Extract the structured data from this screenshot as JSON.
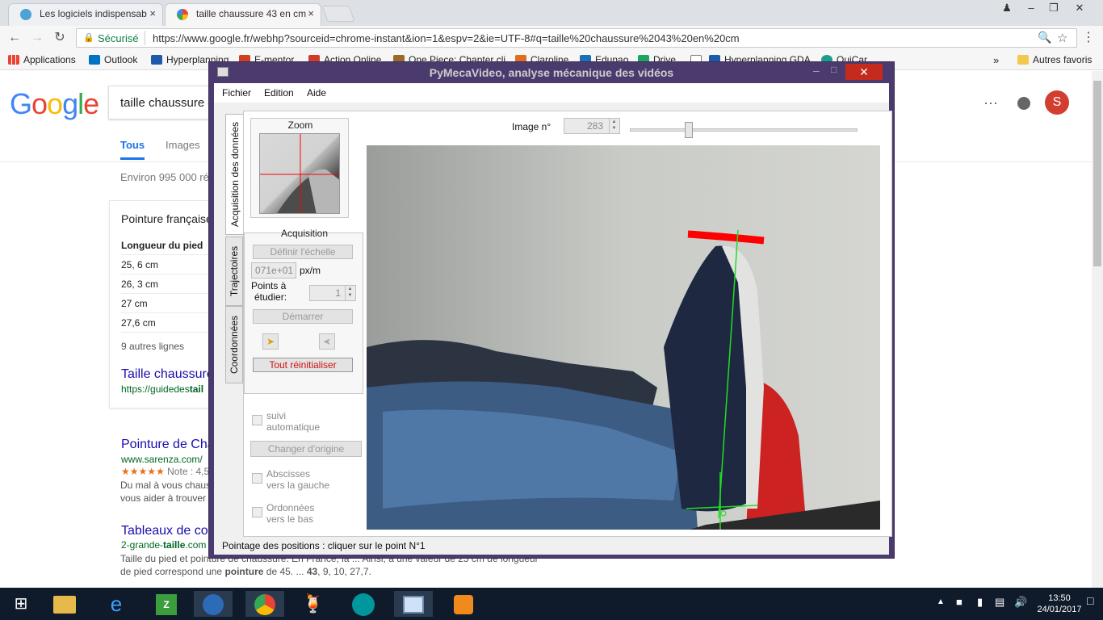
{
  "browser": {
    "tabs": [
      {
        "title": "Les logiciels indispensab",
        "close": "×"
      },
      {
        "title": "taille chaussure 43 en cm",
        "close": "×"
      }
    ],
    "omnibox": {
      "secure_label": "Sécurisé",
      "url": "https://www.google.fr/webhp?sourceid=chrome-instant&ion=1&espv=2&ie=UTF-8#q=taille%20chaussure%2043%20en%20cm"
    },
    "bookmarks": [
      {
        "label": "Applications",
        "color": "#4285f4"
      },
      {
        "label": "Outlook",
        "color": "#0072c6"
      },
      {
        "label": "Hyperplanning",
        "color": "#1e5aa8"
      },
      {
        "label": "E-mentor",
        "color": "#d04020"
      },
      {
        "label": "Action Online",
        "color": "#d13b2b"
      },
      {
        "label": "One Piece: Chapter cli",
        "color": "#9a6b2b"
      },
      {
        "label": "Claroline",
        "color": "#e06d1f"
      },
      {
        "label": "Edunao",
        "color": "#1f6fb5"
      },
      {
        "label": "Drive",
        "color": "#1fa463"
      },
      {
        "label": "",
        "color": "#777777"
      },
      {
        "label": "Hyperplanning GDA",
        "color": "#1e5aa8"
      },
      {
        "label": "QuiCar",
        "color": "#1a9e8a"
      }
    ],
    "bookmarks_more": "»",
    "other_bookmarks": "Autres favoris"
  },
  "google": {
    "logo": "Google",
    "query": "taille chaussure 4",
    "tabs": [
      "Tous",
      "Images"
    ],
    "result_count": "Environ 995 000 rés",
    "card": {
      "title": "Pointure française",
      "header": "Longueur du pied",
      "rows": [
        "25, 6 cm",
        "26, 3 cm",
        "27 cm",
        "27,6 cm"
      ],
      "more": "9 autres lignes",
      "link": "Taille chaussure",
      "url_prefix": "https://guidedes",
      "url_bold": "tail"
    },
    "results": [
      {
        "title": "Pointure de Cha",
        "url": "www.sarenza.com/",
        "rating": "★★★★★",
        "rating_note": "Note : 4,5",
        "snippet1": "Du mal à vous chaus",
        "snippet2": "vous aider à trouver"
      },
      {
        "title": "Tableaux de co",
        "url_prefix": "2-grande-",
        "url_bold": "taille",
        "url_suffix": ".com",
        "snippet1": "Taille du pied et pointure de chaussure. En France, la ... Ainsi, à une valeur de 25 cm de longueur",
        "snippet2_a": "de pied correspond une ",
        "snippet2_b": "pointure",
        "snippet2_c": " de 45. ... ",
        "snippet2_d": "43",
        "snippet2_e": ", 9, 10, 27,7."
      }
    ],
    "avatar_letter": "S"
  },
  "app": {
    "title": "PyMecaVideo, analyse mécanique des vidéos",
    "close": "✕",
    "menus": [
      "Fichier",
      "Edition",
      "Aide"
    ],
    "side_tabs": [
      "Acquisition des données",
      "Trajectoires",
      "Coordonnées"
    ],
    "zoom_title": "Zoom",
    "acquisition": {
      "title": "Acquisition",
      "define_scale": "Définir l'échelle",
      "scale_value": "071e+01",
      "scale_unit": "px/m",
      "points_label_1": "Points à",
      "points_label_2": "étudier:",
      "points_value": "1",
      "start": "Démarrer",
      "reset": "Tout réinitialiser"
    },
    "options": {
      "auto_1": "suivi",
      "auto_2": "automatique",
      "change_origin": "Changer d'origine",
      "abscissa_1": "Abscisses",
      "abscissa_2": "vers la gauche",
      "ordinate_1": "Ordonnées",
      "ordinate_2": "vers le bas"
    },
    "image_label": "Image n°",
    "image_number": "283",
    "image_slider_fraction": 0.25,
    "status": "Pointage des positions : cliquer sur le point N°1",
    "colors": {
      "reset_text": "#d01010",
      "track": "#ff0000",
      "axes": "#22dd22"
    }
  },
  "taskbar": {
    "icons": [
      "windows-logo",
      "file-explorer",
      "edge",
      "zip-tool",
      "thunderbird",
      "chrome",
      "fruit-app",
      "arduino",
      "pymecavideo",
      "media-player"
    ],
    "time": "13:50",
    "date": "24/01/2017"
  }
}
